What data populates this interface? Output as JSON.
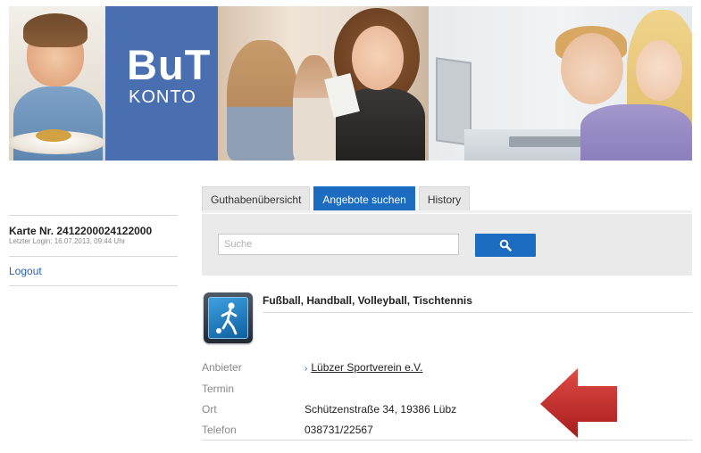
{
  "banner": {
    "logo_main": "BuT",
    "logo_sub": "KONTO",
    "logo_color": "#4a6fb0"
  },
  "sidebar": {
    "card_label": "Karte Nr. 2412200024122000",
    "last_login": "Letzter Login: 16.07.2013, 09:44 Uhr",
    "logout_label": "Logout"
  },
  "tabs": [
    {
      "label": "Guthabenübersicht",
      "active": false
    },
    {
      "label": "Angebote suchen",
      "active": true
    },
    {
      "label": "History",
      "active": false
    }
  ],
  "search": {
    "placeholder": "Suche",
    "value": "",
    "button_icon": "search-icon"
  },
  "result": {
    "icon": "sport-activity-icon",
    "title": "Fußball, Handball, Volleyball, Tischtennis",
    "fields": [
      {
        "label": "Anbieter",
        "value": "Lübzer Sportverein e.V.",
        "link": true
      },
      {
        "label": "Termin",
        "value": ""
      },
      {
        "label": "Ort",
        "value": "Schützenstraße 34, 19386 Lübz"
      },
      {
        "label": "Telefon",
        "value": "038731/22567"
      }
    ]
  },
  "colors": {
    "accent": "#1c6cc2",
    "link": "#2a62b5",
    "arrow": "#c42b2b"
  }
}
